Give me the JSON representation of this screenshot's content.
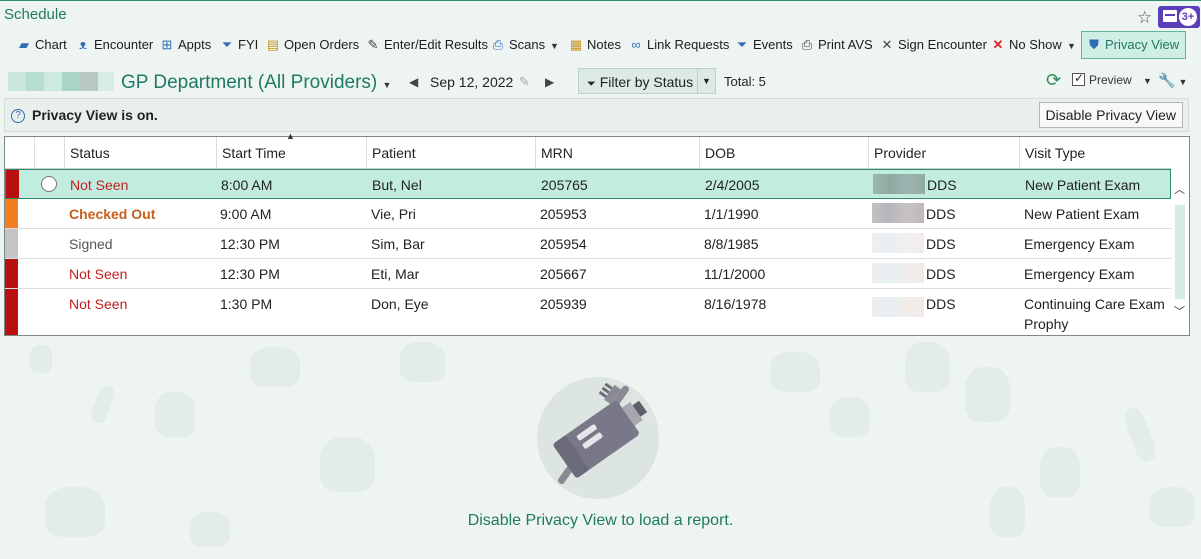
{
  "window": {
    "title": "Schedule",
    "badge_count": "3+"
  },
  "toolbar": {
    "items": [
      {
        "label": "Chart",
        "icon": "folder-icon"
      },
      {
        "label": "Encounter",
        "icon": "stethoscope-icon"
      },
      {
        "label": "Appts",
        "icon": "appointments-icon"
      },
      {
        "label": "FYI",
        "icon": "flag-icon"
      },
      {
        "label": "Open Orders",
        "icon": "clipboard-icon"
      },
      {
        "label": "Enter/Edit Results",
        "icon": "pencil-icon"
      },
      {
        "label": "Scans",
        "icon": "scan-icon"
      },
      {
        "label": "Notes",
        "icon": "notes-icon"
      },
      {
        "label": "Link Requests",
        "icon": "link-icon"
      },
      {
        "label": "Events",
        "icon": "events-icon"
      },
      {
        "label": "Print AVS",
        "icon": "printer-icon"
      },
      {
        "label": "Sign Encounter",
        "icon": "sign-icon"
      },
      {
        "label": "No Show",
        "icon": "x-icon"
      },
      {
        "label": "Privacy View",
        "icon": "shield-icon"
      }
    ]
  },
  "department": {
    "name": "GP Department (All Providers)"
  },
  "date_nav": {
    "date": "Sep 12, 2022"
  },
  "filter": {
    "label": "Filter by Status"
  },
  "total": {
    "label": "Total: 5"
  },
  "preview": {
    "label": "Preview"
  },
  "banner": {
    "message": "Privacy View is on.",
    "disable_label": "Disable Privacy View"
  },
  "table": {
    "columns": [
      "Status",
      "Start Time",
      "Patient",
      "MRN",
      "DOB",
      "Provider",
      "Visit Type"
    ],
    "rows": [
      {
        "status": "Not Seen",
        "status_color": "#c21f1f",
        "bar_color": "#b80f0f",
        "time": "8:00 AM",
        "patient": "But, Nel",
        "mrn": "205765",
        "dob": "2/4/2005",
        "provider": "DDS",
        "visit": "New Patient Exam",
        "visit2": ""
      },
      {
        "status": "Checked Out",
        "status_color": "#c85f1a",
        "bar_color": "#f57d1e",
        "time": "9:00 AM",
        "patient": "Vie, Pri",
        "mrn": "205953",
        "dob": "1/1/1990",
        "provider": "DDS",
        "visit": "New Patient Exam",
        "visit2": ""
      },
      {
        "status": "Signed",
        "status_color": "#555555",
        "bar_color": "#c4c4c4",
        "time": "12:30 PM",
        "patient": "Sim, Bar",
        "mrn": "205954",
        "dob": "8/8/1985",
        "provider": "DDS",
        "visit": "Emergency Exam",
        "visit2": ""
      },
      {
        "status": "Not Seen",
        "status_color": "#c21f1f",
        "bar_color": "#b80f0f",
        "time": "12:30 PM",
        "patient": "Eti, Mar",
        "mrn": "205667",
        "dob": "11/1/2000",
        "provider": "DDS",
        "visit": "Emergency Exam",
        "visit2": ""
      },
      {
        "status": "Not Seen",
        "status_color": "#c21f1f",
        "bar_color": "#b80f0f",
        "time": "1:30 PM",
        "patient": "Don, Eye",
        "mrn": "205939",
        "dob": "8/16/1978",
        "provider": "DDS",
        "visit": "Continuing Care Exam",
        "visit2": "Prophy"
      }
    ]
  },
  "empty_state": {
    "message": "Disable Privacy View to load a report."
  },
  "colors": {
    "accent": "#1f7a63",
    "selected_row": "#c3ece1",
    "not_seen": "#c21f1f",
    "checked_out": "#c85f1a"
  }
}
